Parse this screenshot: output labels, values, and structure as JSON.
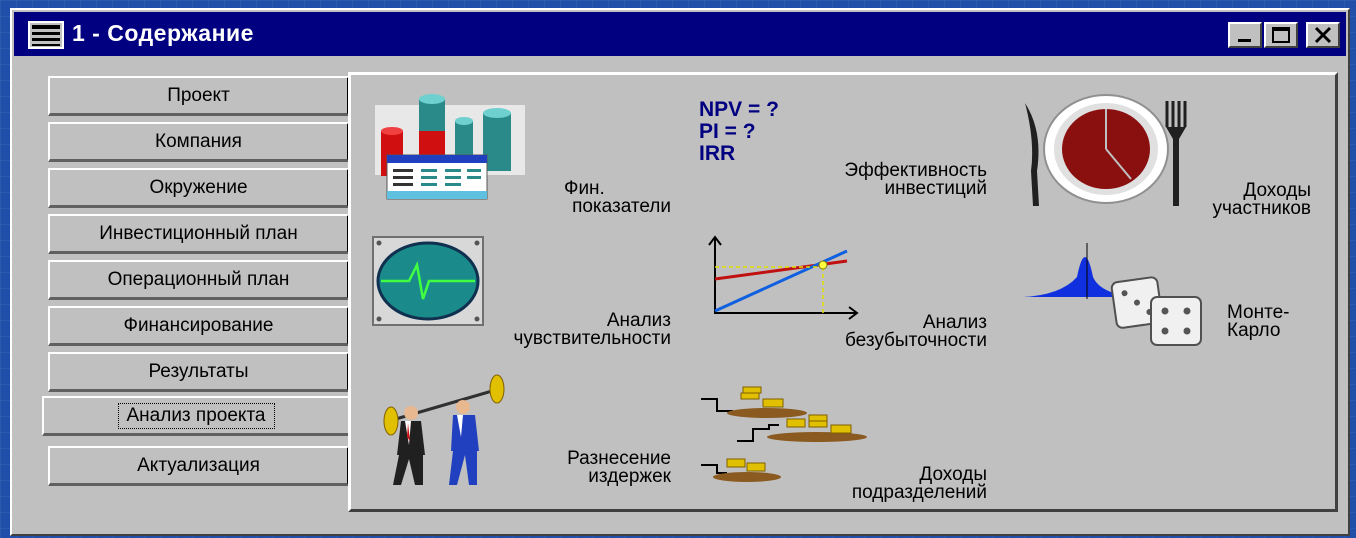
{
  "window": {
    "title": "1 - Содержание"
  },
  "tabs": [
    {
      "label": "Проект"
    },
    {
      "label": "Компания"
    },
    {
      "label": "Окружение"
    },
    {
      "label": "Инвестиционный план"
    },
    {
      "label": "Операционный план"
    },
    {
      "label": "Финансирование"
    },
    {
      "label": "Результаты"
    },
    {
      "label": "Анализ проекта",
      "active": true
    },
    {
      "label": "Актуализация"
    }
  ],
  "items": {
    "fin": {
      "line1": "Фин.",
      "line2": "показатели",
      "icon": "financial-indicators-icon"
    },
    "eff": {
      "npv": "NPV = ?",
      "pi": "PI = ?",
      "irr": "IRR",
      "line1": "Эффективность",
      "line2": "инвестиций",
      "icon": "efficiency-icon"
    },
    "income": {
      "line1": "Доходы",
      "line2": "участников",
      "icon": "plate-pie-icon"
    },
    "sens": {
      "line1": "Анализ",
      "line2": "чувствительности",
      "icon": "oscilloscope-icon"
    },
    "be": {
      "line1": "Анализ",
      "line2": "безубыточности",
      "icon": "break-even-chart-icon"
    },
    "mc": {
      "line1": "Монте-",
      "line2": "Карло",
      "icon": "dice-distribution-icon"
    },
    "cost": {
      "line1": "Разнесение",
      "line2": "издержек",
      "icon": "weightlifters-icon"
    },
    "div": {
      "line1": "Доходы",
      "line2": "подразделений",
      "icon": "coin-stairs-icon"
    }
  },
  "colors": {
    "titlebar": "#000080",
    "window": "#c0c0c0",
    "desktop": "#1f4fa8"
  }
}
